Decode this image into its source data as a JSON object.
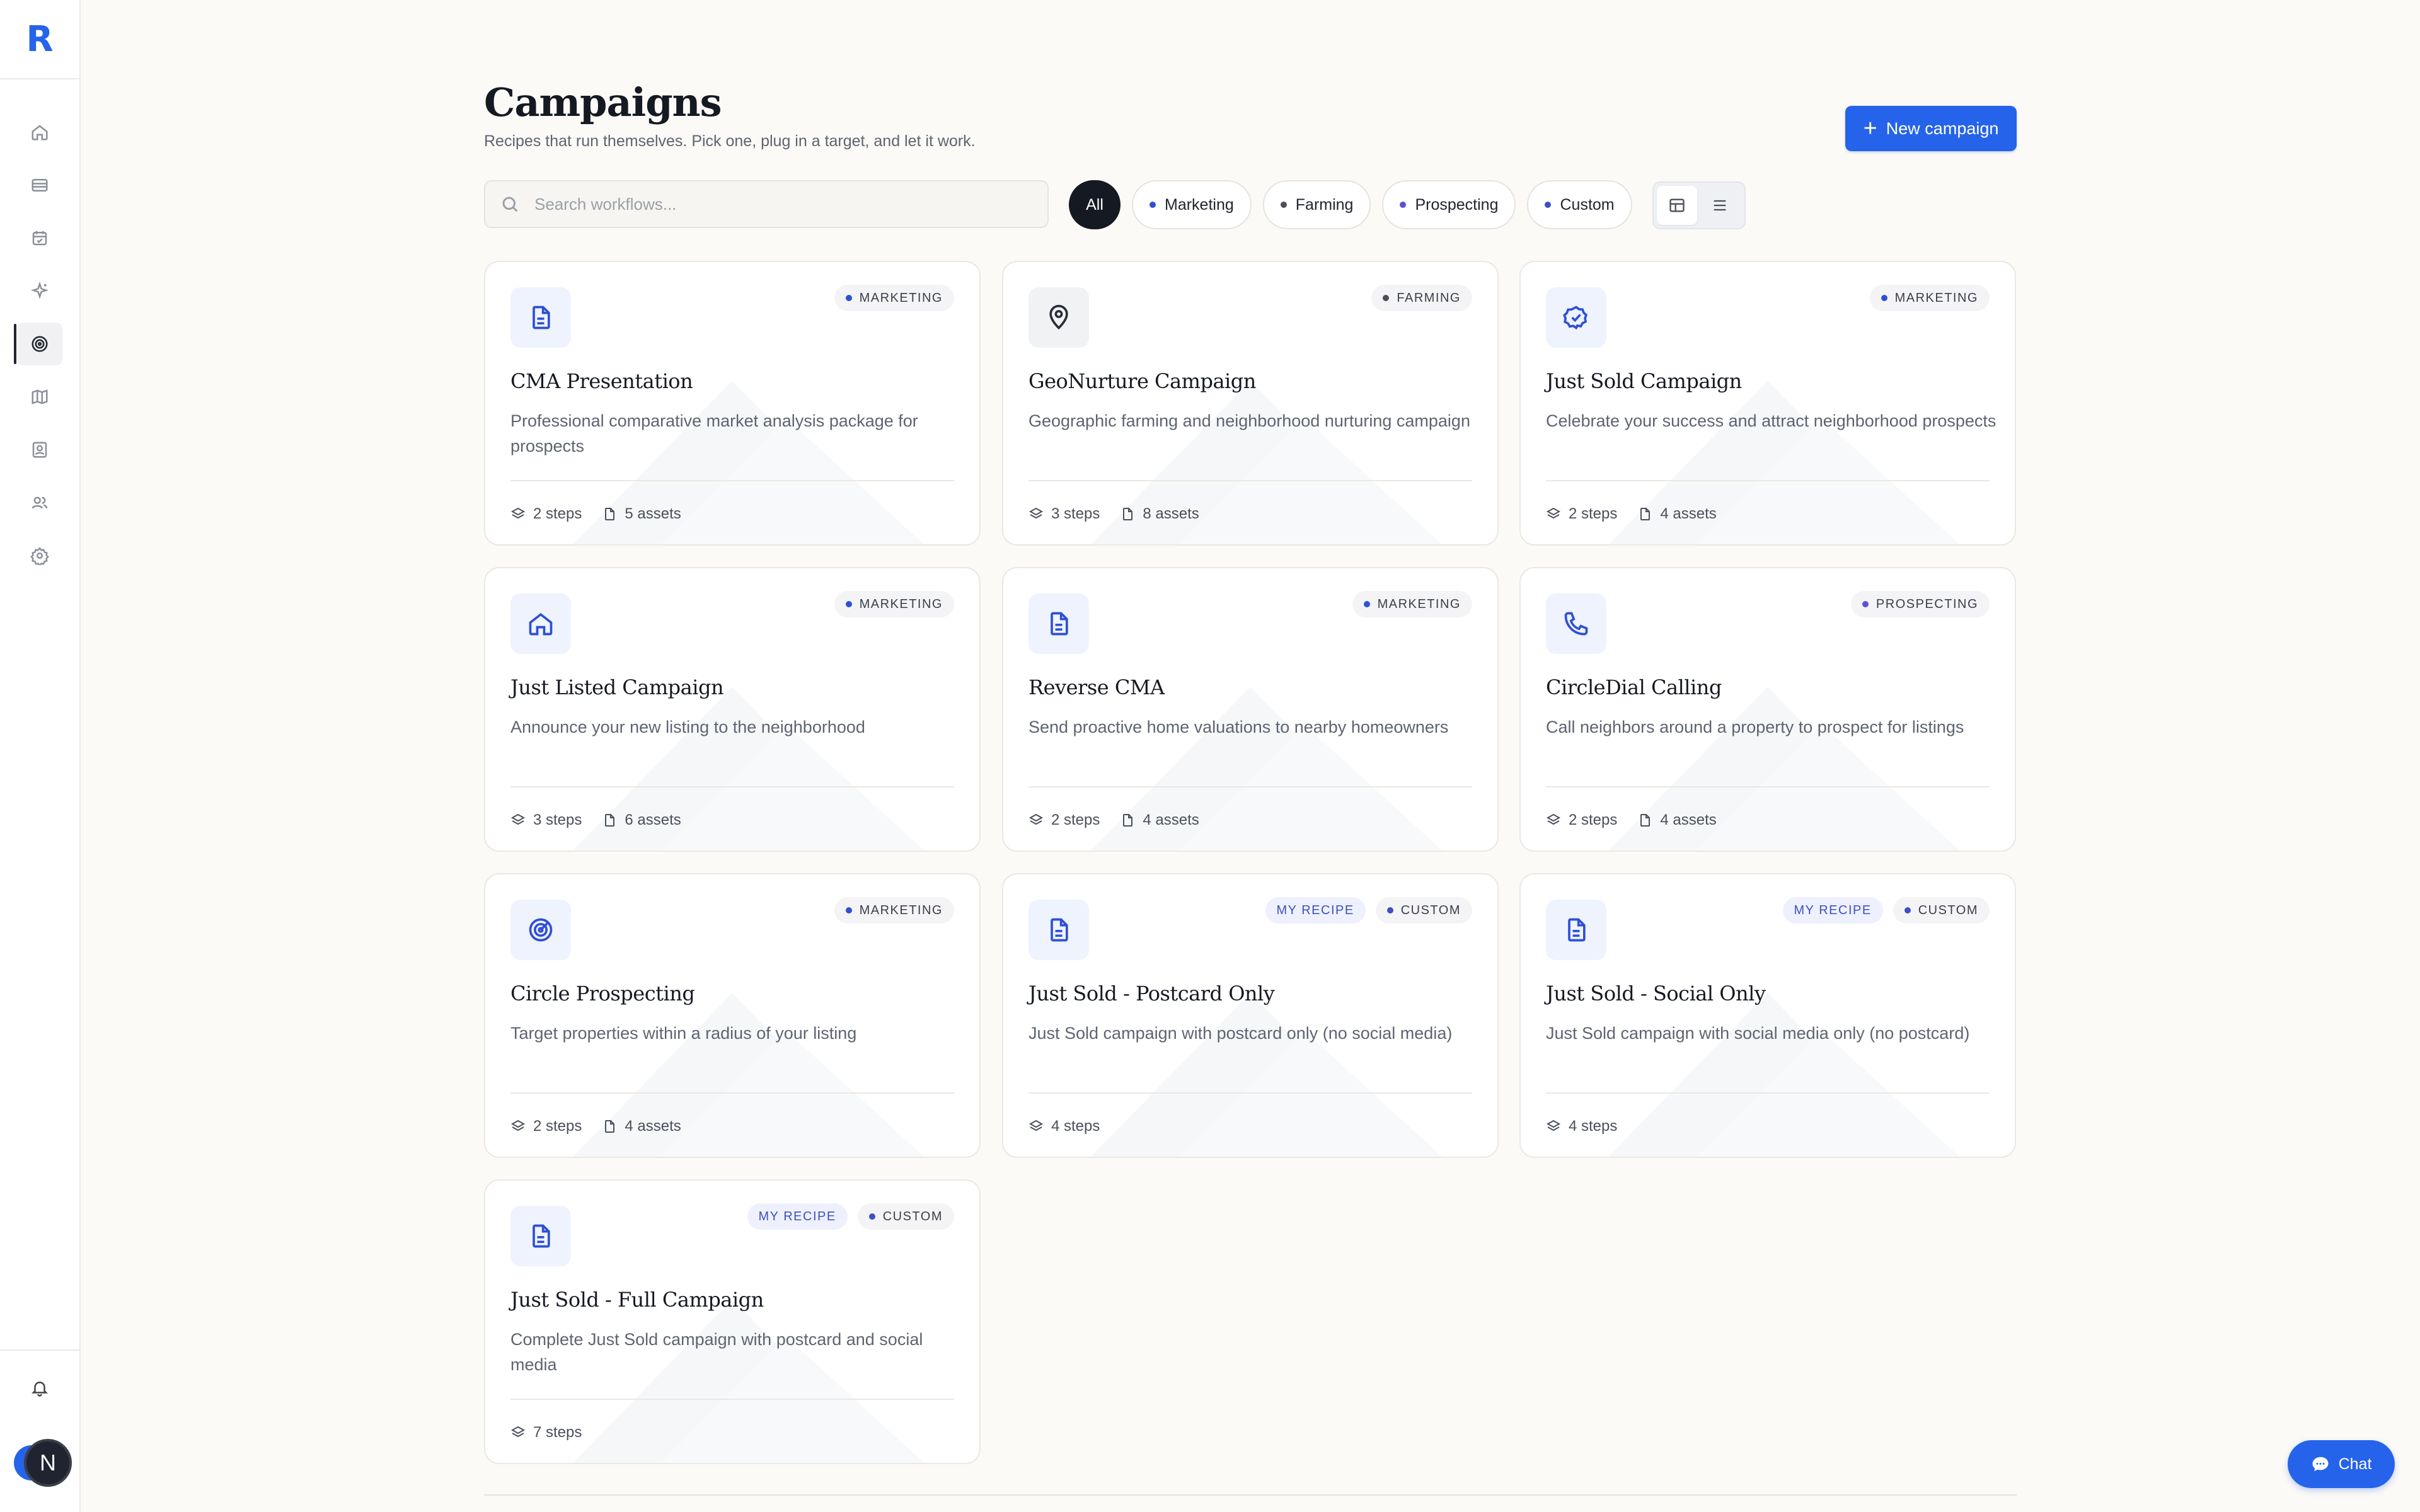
{
  "brand": {
    "logo": "R",
    "accent": "#2563eb"
  },
  "page": {
    "title": "Campaigns",
    "subtitle": "Recipes that run themselves. Pick one, plug in a target, and let it work."
  },
  "actions": {
    "new_campaign": "New campaign",
    "chat": "Chat"
  },
  "search": {
    "placeholder": "Search workflows..."
  },
  "filters": [
    {
      "label": "All",
      "active": true
    },
    {
      "label": "Marketing",
      "dot": "#2f4fd6"
    },
    {
      "label": "Farming",
      "dot": "#4a4f5a"
    },
    {
      "label": "Prospecting",
      "dot": "#5b50d6"
    },
    {
      "label": "Custom",
      "dot": "#3d50c2"
    }
  ],
  "sidebar": {
    "items": [
      {
        "icon": "home-icon"
      },
      {
        "icon": "list-icon"
      },
      {
        "icon": "calendar-check-icon"
      },
      {
        "icon": "sparkle-icon"
      },
      {
        "icon": "target-icon",
        "active": true
      },
      {
        "icon": "map-icon"
      },
      {
        "icon": "contact-book-icon"
      },
      {
        "icon": "users-icon"
      },
      {
        "icon": "settings-icon"
      }
    ],
    "avatar_initial": "N"
  },
  "cards": [
    {
      "name": "CMA Presentation",
      "desc": "Professional comparative market analysis package for prospects",
      "icon": "document",
      "category": "MARKETING",
      "cat_color": "#2f4fd6",
      "steps": "2 steps",
      "assets": "5 assets"
    },
    {
      "name": "GeoNurture Campaign",
      "desc": "Geographic farming and neighborhood nurturing campaign",
      "icon": "map-pin",
      "category": "FARMING",
      "cat_color": "#4a4f5a",
      "steps": "3 steps",
      "assets": "8 assets"
    },
    {
      "name": "Just Sold Campaign",
      "desc": "Celebrate your success and attract neighborhood prospects",
      "icon": "badge-check",
      "category": "MARKETING",
      "cat_color": "#2f4fd6",
      "steps": "2 steps",
      "assets": "4 assets"
    },
    {
      "name": "Just Listed Campaign",
      "desc": "Announce your new listing to the neighborhood",
      "icon": "home",
      "category": "MARKETING",
      "cat_color": "#2f4fd6",
      "steps": "3 steps",
      "assets": "6 assets"
    },
    {
      "name": "Reverse CMA",
      "desc": "Send proactive home valuations to nearby homeowners",
      "icon": "document",
      "category": "MARKETING",
      "cat_color": "#2f4fd6",
      "steps": "2 steps",
      "assets": "4 assets"
    },
    {
      "name": "CircleDial Calling",
      "desc": "Call neighbors around a property to prospect for listings",
      "icon": "phone",
      "category": "PROSPECTING",
      "cat_color": "#5b50d6",
      "steps": "2 steps",
      "assets": "4 assets"
    },
    {
      "name": "Circle Prospecting",
      "desc": "Target properties within a radius of your listing",
      "icon": "target",
      "category": "MARKETING",
      "cat_color": "#2f4fd6",
      "steps": "2 steps",
      "assets": "4 assets"
    },
    {
      "name": "Just Sold - Postcard Only",
      "desc": "Just Sold campaign with postcard only (no social media)",
      "icon": "document",
      "category": "CUSTOM",
      "cat_color": "#3d50c2",
      "recipe": "MY RECIPE",
      "steps": "4 steps",
      "assets": ""
    },
    {
      "name": "Just Sold - Social Only",
      "desc": "Just Sold campaign with social media only (no postcard)",
      "icon": "document",
      "category": "CUSTOM",
      "cat_color": "#3d50c2",
      "recipe": "MY RECIPE",
      "steps": "4 steps",
      "assets": ""
    },
    {
      "name": "Just Sold - Full Campaign",
      "desc": "Complete Just Sold campaign with postcard and social media",
      "icon": "document",
      "category": "CUSTOM",
      "cat_color": "#3d50c2",
      "recipe": "MY RECIPE",
      "steps": "7 steps",
      "assets": ""
    }
  ]
}
